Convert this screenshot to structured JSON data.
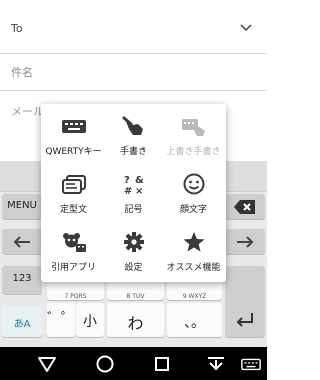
{
  "compose": {
    "to_label": "To",
    "subject_label": "件名",
    "body_label": "メール"
  },
  "keyboard": {
    "menu_label": "MENU",
    "num_mode_label": "123",
    "kana_mode_label": "あA",
    "keys": {
      "dakuten": "゛゜",
      "ko": "小",
      "wa": "わ",
      "punct": "、。"
    },
    "row3_subs": [
      "7",
      "PQRS",
      "8",
      "TUV",
      "9",
      "WXYZ"
    ]
  },
  "popup": {
    "items": [
      {
        "label": "QWERTYキー",
        "icon": "keyboard-icon",
        "enabled": true
      },
      {
        "label": "手書き",
        "icon": "handwriting-icon",
        "enabled": true
      },
      {
        "label": "上書き手書き",
        "icon": "overwrite-handwriting-icon",
        "enabled": false
      },
      {
        "label": "定型文",
        "icon": "template-text-icon",
        "enabled": true
      },
      {
        "label": "記号",
        "icon": "symbols-icon",
        "enabled": true
      },
      {
        "label": "顔文字",
        "icon": "emoticon-icon",
        "enabled": true
      },
      {
        "label": "引用アプリ",
        "icon": "quote-app-icon",
        "enabled": true
      },
      {
        "label": "設定",
        "icon": "settings-gear-icon",
        "enabled": true
      },
      {
        "label": "オススメ機能",
        "icon": "star-icon",
        "enabled": true
      }
    ]
  },
  "colors": {
    "icon_dark": "#3a3a3a",
    "icon_disabled": "#b9b9b9",
    "navbar": "#000000"
  }
}
